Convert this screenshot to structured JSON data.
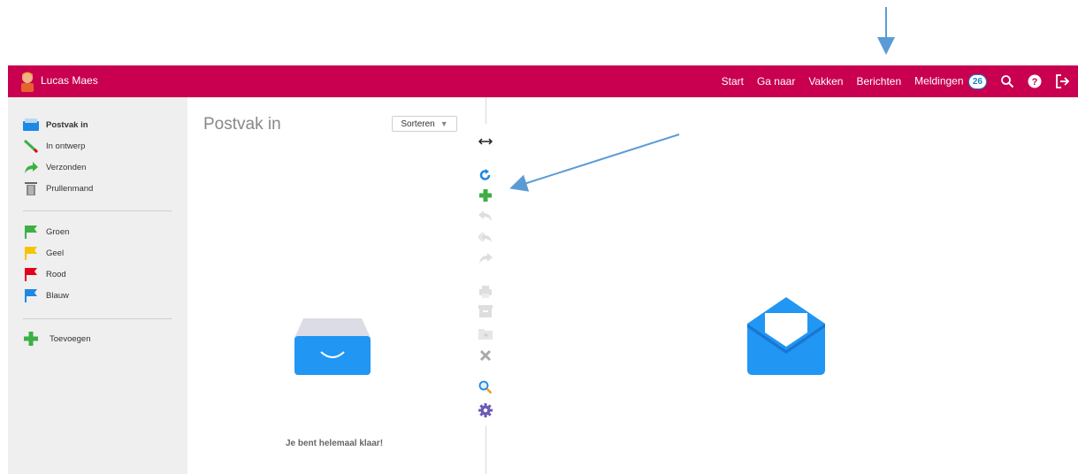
{
  "user": {
    "name": "Lucas Maes"
  },
  "topnav": {
    "start": "Start",
    "ganaar": "Ga naar",
    "vakken": "Vakken",
    "berichten": "Berichten",
    "meldingen": "Meldingen",
    "meldingen_count": "26"
  },
  "sidebar": {
    "folders": [
      {
        "label": "Postvak in",
        "icon": "inbox-icon"
      },
      {
        "label": "In ontwerp",
        "icon": "pencil-icon"
      },
      {
        "label": "Verzonden",
        "icon": "sent-arrow-icon"
      },
      {
        "label": "Prullenmand",
        "icon": "trash-icon"
      }
    ],
    "flags": [
      {
        "label": "Groen",
        "color": "#3cb043"
      },
      {
        "label": "Geel",
        "color": "#f5c400"
      },
      {
        "label": "Rood",
        "color": "#e3001b"
      },
      {
        "label": "Blauw",
        "color": "#1e88e5"
      }
    ],
    "add_label": "Toevoegen"
  },
  "listpane": {
    "title": "Postvak in",
    "sort_label": "Sorteren",
    "empty_message": "Je bent helemaal klaar!"
  },
  "colors": {
    "brand": "#c8004f",
    "accent": "#1e88e5",
    "sidebar_bg": "#efefef"
  }
}
